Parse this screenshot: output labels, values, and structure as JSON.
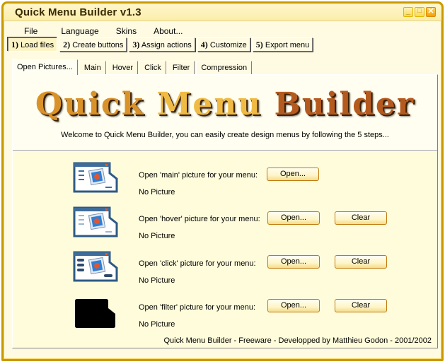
{
  "window": {
    "title": "Quick Menu Builder  v1.3",
    "controls": {
      "minimize": "_",
      "maximize": "□",
      "close": "✕"
    }
  },
  "menubar": {
    "items": [
      {
        "label": "File"
      },
      {
        "label": "Language"
      },
      {
        "label": "Skins"
      },
      {
        "label": "About..."
      }
    ]
  },
  "steps": [
    {
      "num": "1)",
      "label": "Load files",
      "active": true
    },
    {
      "num": "2)",
      "label": "Create buttons",
      "active": false
    },
    {
      "num": "3)",
      "label": "Assign actions",
      "active": false
    },
    {
      "num": "4)",
      "label": "Customize",
      "active": false
    },
    {
      "num": "5)",
      "label": "Export menu",
      "active": false
    }
  ],
  "tabs": [
    {
      "label": "Open Pictures...",
      "active": true
    },
    {
      "label": "Main",
      "active": false
    },
    {
      "label": "Hover",
      "active": false
    },
    {
      "label": "Click",
      "active": false
    },
    {
      "label": "Filter",
      "active": false
    },
    {
      "label": "Compression",
      "active": false
    }
  ],
  "banner": {
    "logo_words": [
      "Quick",
      "Menu",
      "Builder"
    ],
    "welcome": "Welcome to Quick Menu Builder, you can easily create design menus by following the 5 steps..."
  },
  "pictures": [
    {
      "id": "main",
      "icon": "window-picture-icon",
      "label": "Open 'main' picture for your menu:",
      "status": "No Picture",
      "open_label": "Open...",
      "clear_label": null
    },
    {
      "id": "hover",
      "icon": "window-picture-hover-icon",
      "label": "Open 'hover' picture for your menu:",
      "status": "No Picture",
      "open_label": "Open...",
      "clear_label": "Clear"
    },
    {
      "id": "click",
      "icon": "window-picture-click-icon",
      "label": "Open 'click' picture for your menu:",
      "status": "No Picture",
      "open_label": "Open...",
      "clear_label": "Clear"
    },
    {
      "id": "filter",
      "icon": "filter-mask-icon",
      "label": "Open 'filter' picture for your menu:",
      "status": "No Picture",
      "open_label": "Open...",
      "clear_label": "Clear"
    }
  ],
  "footer": "Quick Menu Builder - Freeware - Developped by Matthieu Godon - 2001/2002",
  "colors": {
    "frame": "#c99a00",
    "background": "#fffcdb",
    "button_border": "#c07a10"
  }
}
